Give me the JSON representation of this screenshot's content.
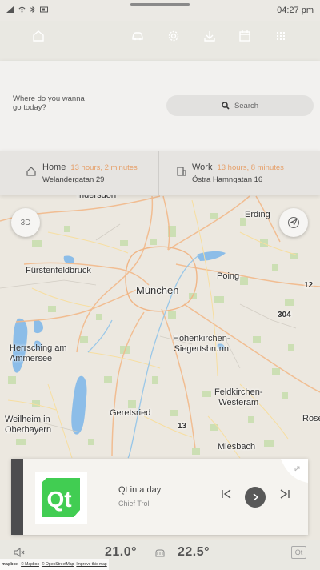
{
  "status_bar": {
    "time": "04:27 pm"
  },
  "nav": {
    "icons": [
      "home-icon",
      "car-icon",
      "gear-icon",
      "download-icon",
      "calendar-icon",
      "apps-icon"
    ]
  },
  "search": {
    "prompt": "Where do you wanna go today?",
    "placeholder": "Search"
  },
  "favorites": {
    "home": {
      "label": "Home",
      "duration": "13 hours, 2 minutes",
      "address": "Welandergatan 29"
    },
    "work": {
      "label": "Work",
      "duration": "13 hours, 8 minutes",
      "address": "Östra Hamngatan 16"
    }
  },
  "map": {
    "btn_3d": "3D",
    "places": {
      "indersdorf": "Indersdorf",
      "erding": "Erding",
      "fuerstenfeldbruck": "Fürstenfeldbruck",
      "poing": "Poing",
      "muenchen": "München",
      "road_12": "12",
      "road_304": "304",
      "herrsching": "Herrsching am\nAmmersee",
      "hohenkirchen": "Hohenkirchen-\nSiegertsbrunn",
      "feldkirchen": "Feldkirchen-\nWesteram",
      "weilheim": "Weilheim in\nOberbayern",
      "geretsried": "Geretsried",
      "rose": "Rose",
      "road_13": "13",
      "miesbach": "Miesbach"
    },
    "attribution": {
      "logo": "mapbox",
      "mapbox": "© Mapbox",
      "osm": "© OpenStreetMap",
      "improve": "Improve this map"
    }
  },
  "media": {
    "cover_text": "Qt",
    "track": "Qt in a day",
    "artist": "Chief Troll"
  },
  "climate": {
    "left_temp": "21.0°",
    "right_temp": "22.5°"
  },
  "bottom": {
    "qt_label": "Qt"
  },
  "colors": {
    "accent_orange": "#e6a06a",
    "qt_green": "#41cd52",
    "media_strip": "#4d4d4f"
  }
}
